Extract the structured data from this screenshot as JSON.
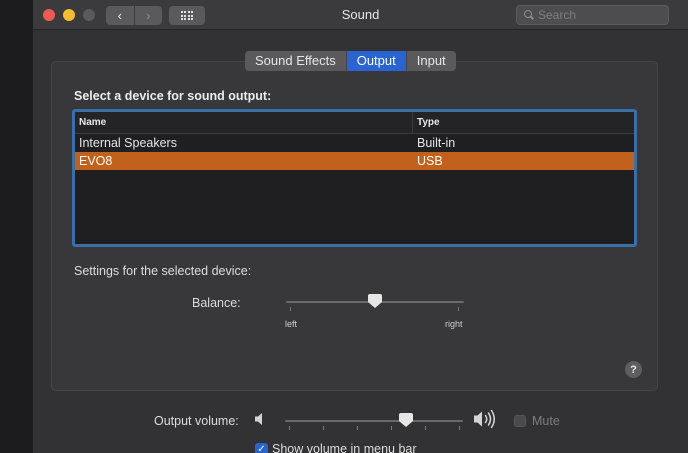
{
  "window": {
    "title": "Sound"
  },
  "toolbar": {
    "back_glyph": "‹",
    "forward_glyph": "›",
    "search_placeholder": "Search"
  },
  "tabs": [
    {
      "label": "Sound Effects",
      "active": false
    },
    {
      "label": "Output",
      "active": true
    },
    {
      "label": "Input",
      "active": false
    }
  ],
  "output": {
    "heading": "Select a device for sound output:",
    "table": {
      "columns": [
        "Name",
        "Type"
      ],
      "rows": [
        {
          "name": "Internal Speakers",
          "type": "Built-in",
          "selected": false
        },
        {
          "name": "EVO8",
          "type": "USB",
          "selected": true
        }
      ]
    },
    "settings_label": "Settings for the selected device:",
    "balance": {
      "label": "Balance:",
      "left_label": "left",
      "right_label": "right",
      "value": 0.5
    },
    "help_glyph": "?"
  },
  "volume": {
    "label": "Output volume:",
    "value": 0.68,
    "mute_label": "Mute",
    "mute_checked": false,
    "show_in_menu_label": "Show volume in menu bar",
    "show_in_menu_checked": true
  },
  "colors": {
    "accent_blue": "#2a64d1",
    "selection_orange": "#c1611b",
    "traffic_red": "#ec5a53",
    "traffic_yellow": "#f2be2f"
  }
}
